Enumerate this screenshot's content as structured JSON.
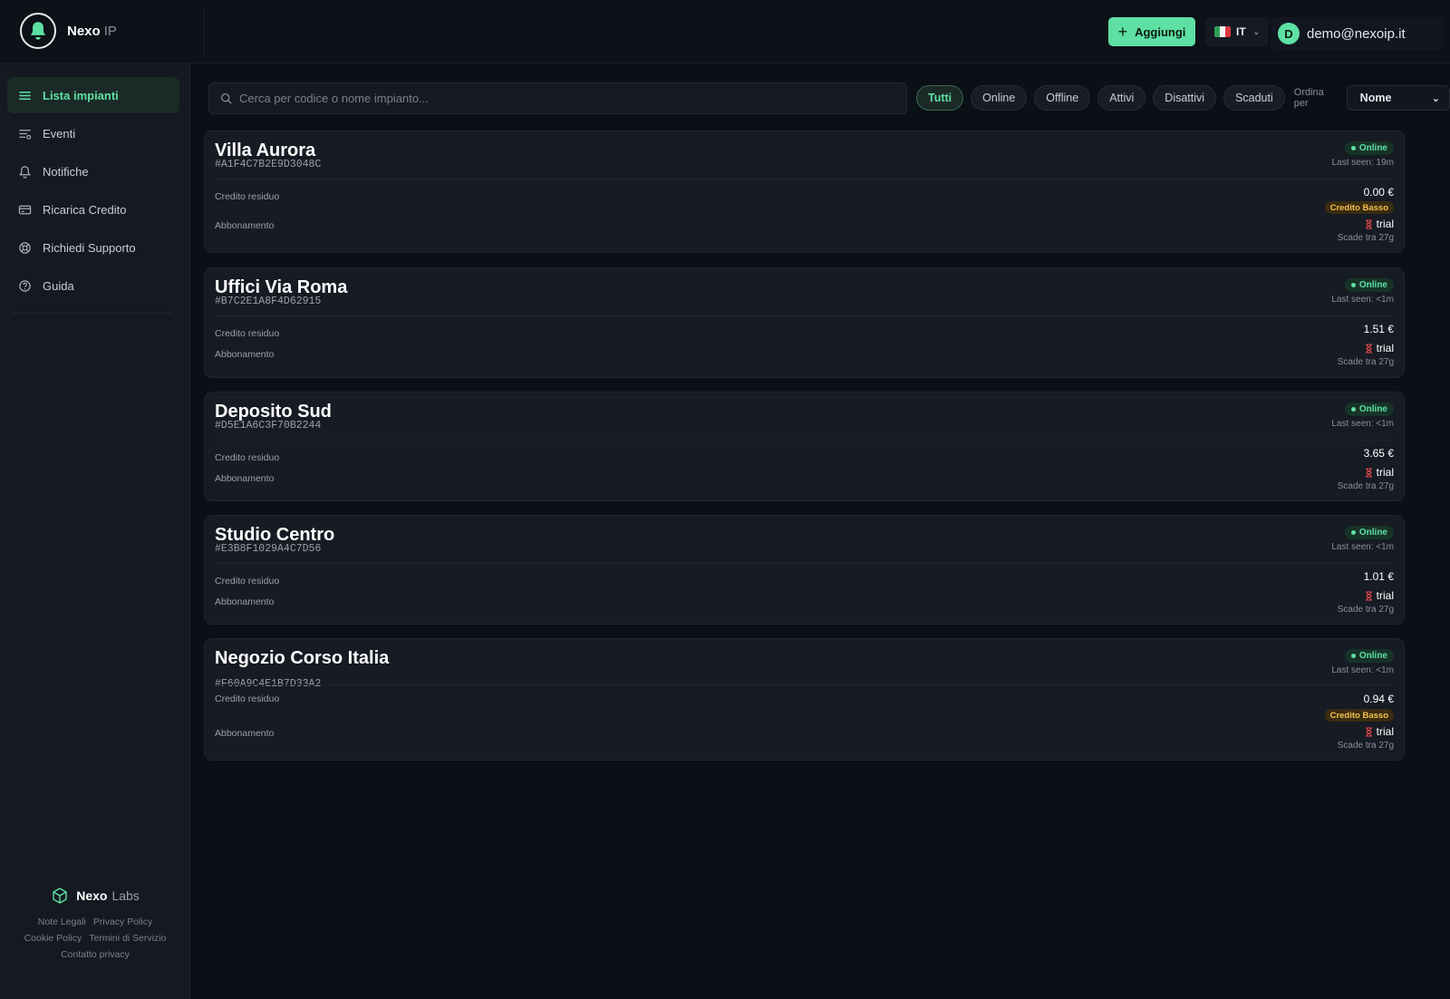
{
  "app": {
    "name": "Nexo",
    "suffix": "IP"
  },
  "header": {
    "add_label": "Aggiungi",
    "lang": "IT",
    "user_initial": "D",
    "user_email": "demo@nexoip.it"
  },
  "sidebar": {
    "items": [
      {
        "label": "Lista impianti",
        "icon": "list-icon",
        "active": true
      },
      {
        "label": "Eventi",
        "icon": "events-icon"
      },
      {
        "label": "Notifiche",
        "icon": "bell-icon"
      },
      {
        "label": "Ricarica Credito",
        "icon": "card-icon"
      },
      {
        "label": "Richiedi Supporto",
        "icon": "lifebuoy-icon"
      },
      {
        "label": "Guida",
        "icon": "help-icon"
      }
    ],
    "footer": {
      "brand": "Nexo",
      "brand_suffix": "Labs",
      "links": [
        "Note Legali",
        "Privacy Policy",
        "Cookie Policy",
        "Termini di Servizio",
        "Contatto privacy"
      ]
    }
  },
  "search": {
    "placeholder": "Cerca per codice o nome impianto..."
  },
  "filters": [
    "Tutti",
    "Online",
    "Offline",
    "Attivi",
    "Disattivi",
    "Scaduti"
  ],
  "sort": {
    "label": "Ordina per",
    "value": "Nome"
  },
  "labels": {
    "credit": "Credito residuo",
    "subscription": "Abbonamento",
    "low_credit": "Credito Basso"
  },
  "colors": {
    "accent": "#5ee0a4",
    "warning": "#f2c14e",
    "danger": "#e5484d"
  },
  "plants": [
    {
      "name": "Villa Aurora",
      "code": "#A1F4C7B2E9D3048C",
      "status": "Online",
      "last_seen": "Last seen: 19m",
      "credit": "0.00 €",
      "low_credit": true,
      "plan": "trial",
      "expires": "Scade tra 27g"
    },
    {
      "name": "Uffici Via Roma",
      "code": "#B7C2E1A8F4D62915",
      "status": "Online",
      "last_seen": "Last seen: <1m",
      "credit": "1.51 €",
      "low_credit": false,
      "plan": "trial",
      "expires": "Scade tra 27g"
    },
    {
      "name": "Deposito Sud",
      "code": "#D5E1A6C3F70B2244",
      "status": "Online",
      "last_seen": "Last seen: <1m",
      "credit": "3.65 €",
      "low_credit": false,
      "plan": "trial",
      "expires": "Scade tra 27g"
    },
    {
      "name": "Studio Centro",
      "code": "#E3B8F1029A4C7D56",
      "status": "Online",
      "last_seen": "Last seen: <1m",
      "credit": "1.01 €",
      "low_credit": false,
      "plan": "trial",
      "expires": "Scade tra 27g"
    },
    {
      "name": "Negozio Corso Italia",
      "code": "#F60A9C4E1B7D33A2",
      "status": "Online",
      "last_seen": "Last seen: <1m",
      "credit": "0.94 €",
      "low_credit": true,
      "plan": "trial",
      "expires": "Scade tra 27g"
    }
  ]
}
